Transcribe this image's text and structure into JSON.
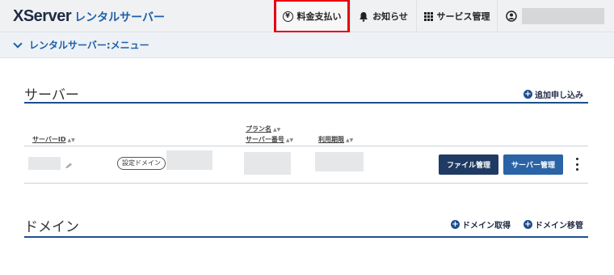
{
  "topbar": {
    "logo_main": "XServer",
    "logo_sub": "レンタルサーバー",
    "nav": {
      "payment": "料金支払い",
      "news": "お知らせ",
      "services": "サービス管理"
    },
    "user_icon": "user-circle-icon"
  },
  "subbar": {
    "title": "レンタルサーバー:メニュー"
  },
  "server_section": {
    "title": "サーバー",
    "add_label": "追加申し込み",
    "columns": {
      "server_id": "サーバーID",
      "plan_name": "プラン名",
      "server_number": "サーバー番号",
      "expiry": "利用期限"
    },
    "row": {
      "domain_badge": "設定ドメイン",
      "file_button": "ファイル管理",
      "server_button": "サーバー管理"
    }
  },
  "domain_section": {
    "title": "ドメイン",
    "acquire_label": "ドメイン取得",
    "transfer_label": "ドメイン移管"
  },
  "colors": {
    "accent": "#1e5fa8",
    "highlight": "#e60012",
    "button_dark": "#1f3b63",
    "button_blue": "#2a63a6"
  }
}
